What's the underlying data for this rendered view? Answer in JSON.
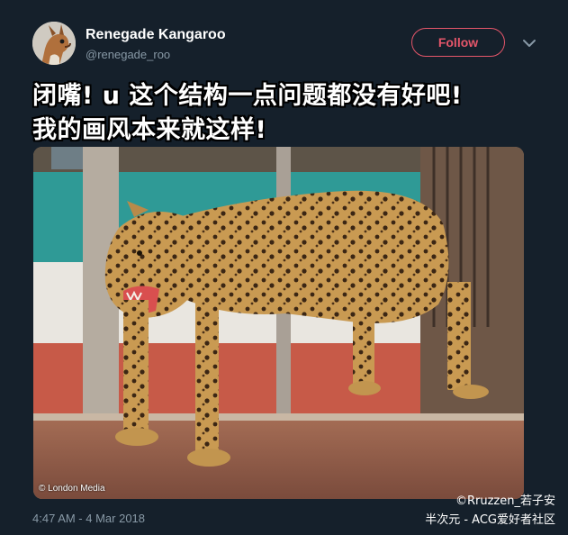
{
  "tweet": {
    "display_name": "Renegade Kangaroo",
    "handle": "@renegade_roo",
    "follow_label": "Follow",
    "caption_line1": "闭嘴! u 这个结构一点问题都没有好吧!",
    "caption_line2": "我的画风本来就这样!",
    "timestamp": "4:47 AM - 4 Mar 2018"
  },
  "media": {
    "credit": "© London Media",
    "subject_icon": "leopard-photo"
  },
  "watermark": {
    "line1": "©Rruzzen_若子安",
    "line2": "半次元 - ACG爱好者社区"
  },
  "colors": {
    "background": "#15202b",
    "follow_accent": "#e5566a",
    "secondary_text": "#8899a6"
  }
}
